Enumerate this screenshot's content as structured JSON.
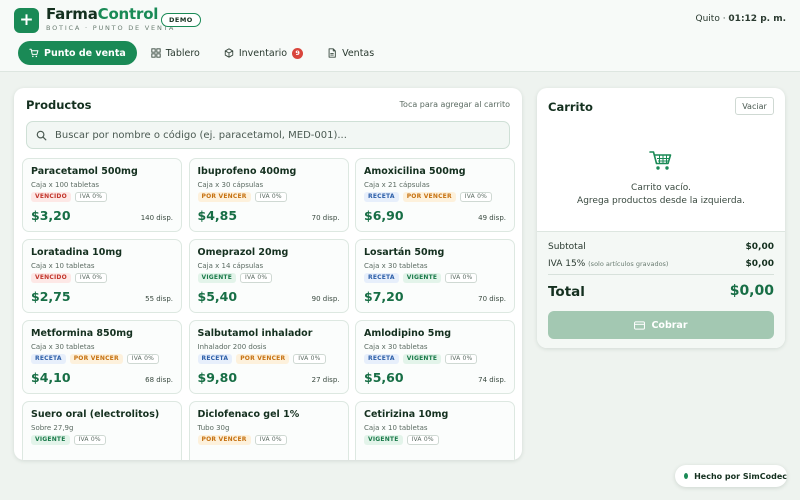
{
  "header": {
    "brand_part1": "Farma",
    "brand_part2": "Control",
    "subtitle": "BOTICA · PUNTO DE VENTA",
    "demo_badge": "DEMO",
    "city": "Quito",
    "time": "01:12 p. m."
  },
  "nav": {
    "tabs": [
      {
        "label": "Punto de venta",
        "icon": "cart-icon",
        "active": true
      },
      {
        "label": "Tablero",
        "icon": "grid-icon",
        "active": false
      },
      {
        "label": "Inventario",
        "icon": "box-icon",
        "active": false,
        "badge": "9"
      },
      {
        "label": "Ventas",
        "icon": "document-icon",
        "active": false
      }
    ]
  },
  "products": {
    "title": "Productos",
    "hint": "Toca para agregar al carrito",
    "search_placeholder": "Buscar por nombre o código (ej. paracetamol, MED-001)...",
    "items": [
      {
        "name": "Paracetamol 500mg",
        "pack": "Caja x 100 tabletas",
        "badges": [
          {
            "text": "VENCIDO",
            "kind": "vencido"
          },
          {
            "text": "IVA 0%",
            "kind": "iva"
          }
        ],
        "price": "$3,20",
        "stock": "140 disp."
      },
      {
        "name": "Ibuprofeno 400mg",
        "pack": "Caja x 30 cápsulas",
        "badges": [
          {
            "text": "POR VENCER",
            "kind": "porvencer"
          },
          {
            "text": "IVA 0%",
            "kind": "iva"
          }
        ],
        "price": "$4,85",
        "stock": "70 disp."
      },
      {
        "name": "Amoxicilina 500mg",
        "pack": "Caja x 21 cápsulas",
        "badges": [
          {
            "text": "RECETA",
            "kind": "receta"
          },
          {
            "text": "POR VENCER",
            "kind": "porvencer"
          },
          {
            "text": "IVA 0%",
            "kind": "iva"
          }
        ],
        "price": "$6,90",
        "stock": "49 disp."
      },
      {
        "name": "Loratadina 10mg",
        "pack": "Caja x 10 tabletas",
        "badges": [
          {
            "text": "VENCIDO",
            "kind": "vencido"
          },
          {
            "text": "IVA 0%",
            "kind": "iva"
          }
        ],
        "price": "$2,75",
        "stock": "55 disp."
      },
      {
        "name": "Omeprazol 20mg",
        "pack": "Caja x 14 cápsulas",
        "badges": [
          {
            "text": "VIGENTE",
            "kind": "vigente"
          },
          {
            "text": "IVA 0%",
            "kind": "iva"
          }
        ],
        "price": "$5,40",
        "stock": "90 disp."
      },
      {
        "name": "Losartán 50mg",
        "pack": "Caja x 30 tabletas",
        "badges": [
          {
            "text": "RECETA",
            "kind": "receta"
          },
          {
            "text": "VIGENTE",
            "kind": "vigente"
          },
          {
            "text": "IVA 0%",
            "kind": "iva"
          }
        ],
        "price": "$7,20",
        "stock": "70 disp."
      },
      {
        "name": "Metformina 850mg",
        "pack": "Caja x 30 tabletas",
        "badges": [
          {
            "text": "RECETA",
            "kind": "receta"
          },
          {
            "text": "POR VENCER",
            "kind": "porvencer"
          },
          {
            "text": "IVA 0%",
            "kind": "iva"
          }
        ],
        "price": "$4,10",
        "stock": "68 disp."
      },
      {
        "name": "Salbutamol inhalador",
        "pack": "Inhalador 200 dosis",
        "badges": [
          {
            "text": "RECETA",
            "kind": "receta"
          },
          {
            "text": "POR VENCER",
            "kind": "porvencer"
          },
          {
            "text": "IVA 0%",
            "kind": "iva"
          }
        ],
        "price": "$9,80",
        "stock": "27 disp."
      },
      {
        "name": "Amlodipino 5mg",
        "pack": "Caja x 30 tabletas",
        "badges": [
          {
            "text": "RECETA",
            "kind": "receta"
          },
          {
            "text": "VIGENTE",
            "kind": "vigente"
          },
          {
            "text": "IVA 0%",
            "kind": "iva"
          }
        ],
        "price": "$5,60",
        "stock": "74 disp."
      },
      {
        "name": "Suero oral (electrolitos)",
        "pack": "Sobre 27,9g",
        "badges": [
          {
            "text": "VIGENTE",
            "kind": "vigente"
          },
          {
            "text": "IVA 0%",
            "kind": "iva"
          }
        ],
        "price": "",
        "stock": ""
      },
      {
        "name": "Diclofenaco gel 1%",
        "pack": "Tubo 30g",
        "badges": [
          {
            "text": "POR VENCER",
            "kind": "porvencer"
          },
          {
            "text": "IVA 0%",
            "kind": "iva"
          }
        ],
        "price": "",
        "stock": ""
      },
      {
        "name": "Cetirizina 10mg",
        "pack": "Caja x 10 tabletas",
        "badges": [
          {
            "text": "VIGENTE",
            "kind": "vigente"
          },
          {
            "text": "IVA 0%",
            "kind": "iva"
          }
        ],
        "price": "",
        "stock": ""
      }
    ]
  },
  "cart": {
    "title": "Carrito",
    "clear_label": "Vaciar",
    "empty_line1": "Carrito vacío.",
    "empty_line2": "Agrega productos desde la izquierda.",
    "subtotal_label": "Subtotal",
    "subtotal_value": "$0,00",
    "iva_label": "IVA 15%",
    "iva_note": "(solo artículos gravados)",
    "iva_value": "$0,00",
    "total_label": "Total",
    "total_value": "$0,00",
    "charge_label": "Cobrar"
  },
  "footer": {
    "made_by": "Hecho por SimCodec"
  },
  "colors": {
    "accent": "#1a8a56",
    "price": "#176e45",
    "vencido": "#c2362c",
    "por_vencer": "#c67212",
    "vigente": "#1a7a4a",
    "receta": "#2d5fa8",
    "badge_red": "#d9453c"
  }
}
